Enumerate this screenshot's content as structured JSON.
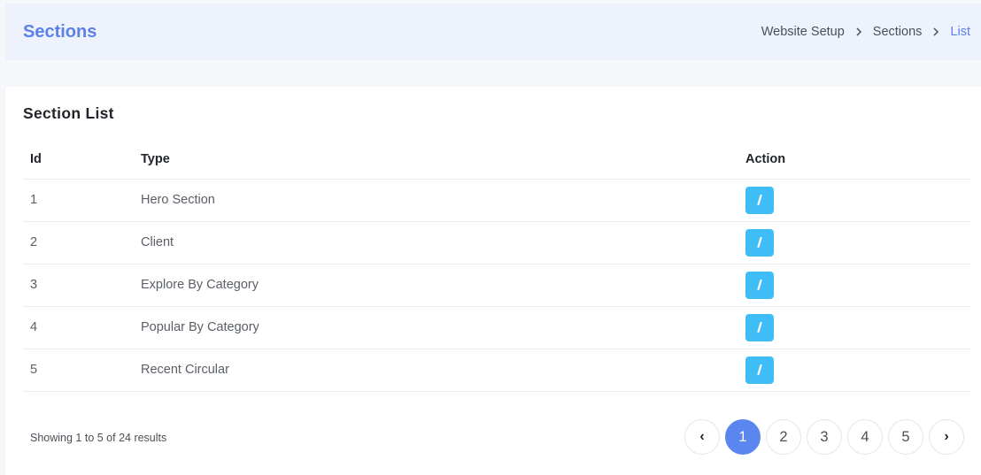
{
  "header": {
    "title": "Sections",
    "breadcrumb": [
      "Website Setup",
      "Sections",
      "List"
    ]
  },
  "card": {
    "title": "Section List",
    "columns": {
      "id": "Id",
      "type": "Type",
      "action": "Action"
    },
    "rows": [
      {
        "id": "1",
        "type": "Hero Section"
      },
      {
        "id": "2",
        "type": "Client"
      },
      {
        "id": "3",
        "type": "Explore By Category"
      },
      {
        "id": "4",
        "type": "Popular By Category"
      },
      {
        "id": "5",
        "type": "Recent Circular"
      }
    ],
    "action_icon": "pencil-icon"
  },
  "footer": {
    "info": "Showing 1 to 5 of 24 results",
    "pages": [
      "1",
      "2",
      "3",
      "4",
      "5"
    ],
    "prev": "‹",
    "next": "›",
    "current_page": "1"
  },
  "colors": {
    "accent": "#5b80e8",
    "edit_button": "#3ebdf7",
    "active_page": "#5b86f0",
    "header_bg": "#eef2fd"
  }
}
